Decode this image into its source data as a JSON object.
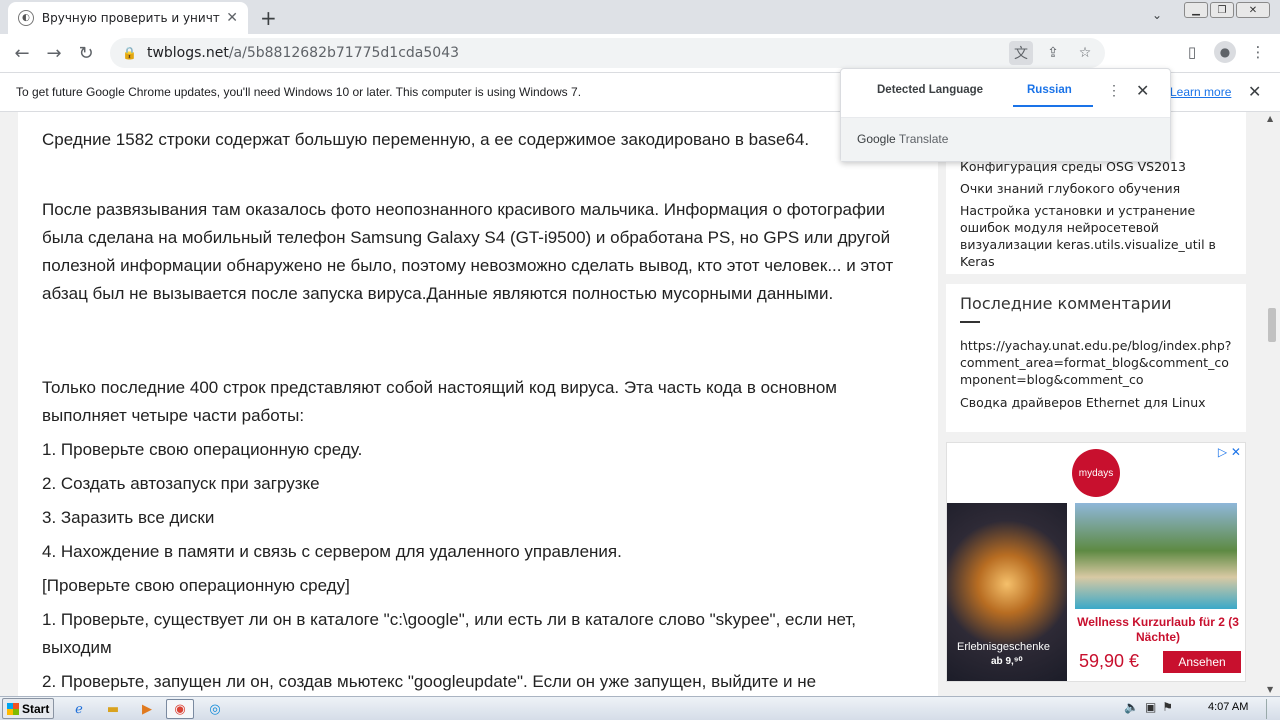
{
  "browser": {
    "tab_title": "Вручную проверить и уничтожить вирус",
    "tab_close": "✕",
    "new_tab": "+",
    "tab_search": "⌄",
    "window_controls": [
      "▁",
      "❐",
      "✕"
    ],
    "url_host": "twblogs.net",
    "url_path": "/a/5b8812682b71775d1cda5043",
    "icons": [
      "back-icon",
      "forward-icon",
      "reload-icon",
      "lock-icon",
      "translate-icon",
      "share-icon",
      "star-icon",
      "sidepanel-icon",
      "profile-icon",
      "menu-icon"
    ]
  },
  "infobar": {
    "message": "To get future Google Chrome updates, you'll need Windows 10 or later. This computer is using Windows 7.",
    "learn_more": "Learn more",
    "close": "✕"
  },
  "translate_popup": {
    "tab_detected": "Detected Language",
    "tab_russian": "Russian",
    "more": "⋮",
    "close": "✕",
    "brand_google": "Google",
    "brand_translate": "Translate"
  },
  "article": {
    "paragraphs": [
      "Средние 1582 строки содержат большую переменную, а ее содержимое закодировано в base64.",
      "После развязывания там оказалось фото неопознанного красивого мальчика. Информация о фотографии была сделана на мобильный телефон Samsung Galaxy S4 (GT-i9500) и обработана PS, но GPS или другой полезной информации обнаружено не было, поэтому невозможно сделать вывод, кто этот человек... и этот абзац был не вызывается после запуска вируса.Данные являются полностью мусорными данными.",
      "Только последние 400 строк представляют собой настоящий код вируса. Эта часть кода в основном выполняет четыре части работы:",
      "1. Проверьте свою операционную среду.",
      "2. Создать автозапуск при загрузке",
      "3. Заразить все диски",
      "4. Нахождение в памяти и связь с сервером для удаленного управления.",
      "[Проверьте свою операционную среду]",
      "1. Проверьте, существует ли он в каталоге \"c:\\google\", или есть ли в каталоге слово \"skypee\", если нет, выходим",
      "2. Проверьте, запущен ли он, создав мьютекс \"googleupdate\". Если он уже запущен, выйдите и не"
    ]
  },
  "sidebar": {
    "recent_posts": [
      "Конфигурация среды OSG VS2013",
      "Очки знаний глубокого обучения",
      "Настройка установки и устранение ошибок модуля нейросетевой визуализации keras.utils.visualize_util в Keras"
    ],
    "comments_heading": "Последние комментарии",
    "comments": [
      "https://yachay.unat.edu.pe/blog/index.php?comment_area=format_blog&comment_component=blog&comment_co",
      "Сводка драйверов Ethernet для Linux"
    ]
  },
  "ad": {
    "brand": "mydays",
    "caption": "Erlebnisgeschenke",
    "small_price": "ab 9,⁹⁰",
    "headline": "Wellness Kurzurlaub für 2 (3 Nächte)",
    "price": "59,90 €",
    "cta": "Ansehen",
    "adchoice": "▷ ✕"
  },
  "taskbar": {
    "start": "Start",
    "time": "4:07 AM",
    "apps": [
      "ie-icon",
      "folder-icon",
      "media-icon",
      "chrome-icon",
      "edge-icon"
    ]
  },
  "colors": {
    "accent": "#1a73e8",
    "ad_red": "#c8102e"
  }
}
